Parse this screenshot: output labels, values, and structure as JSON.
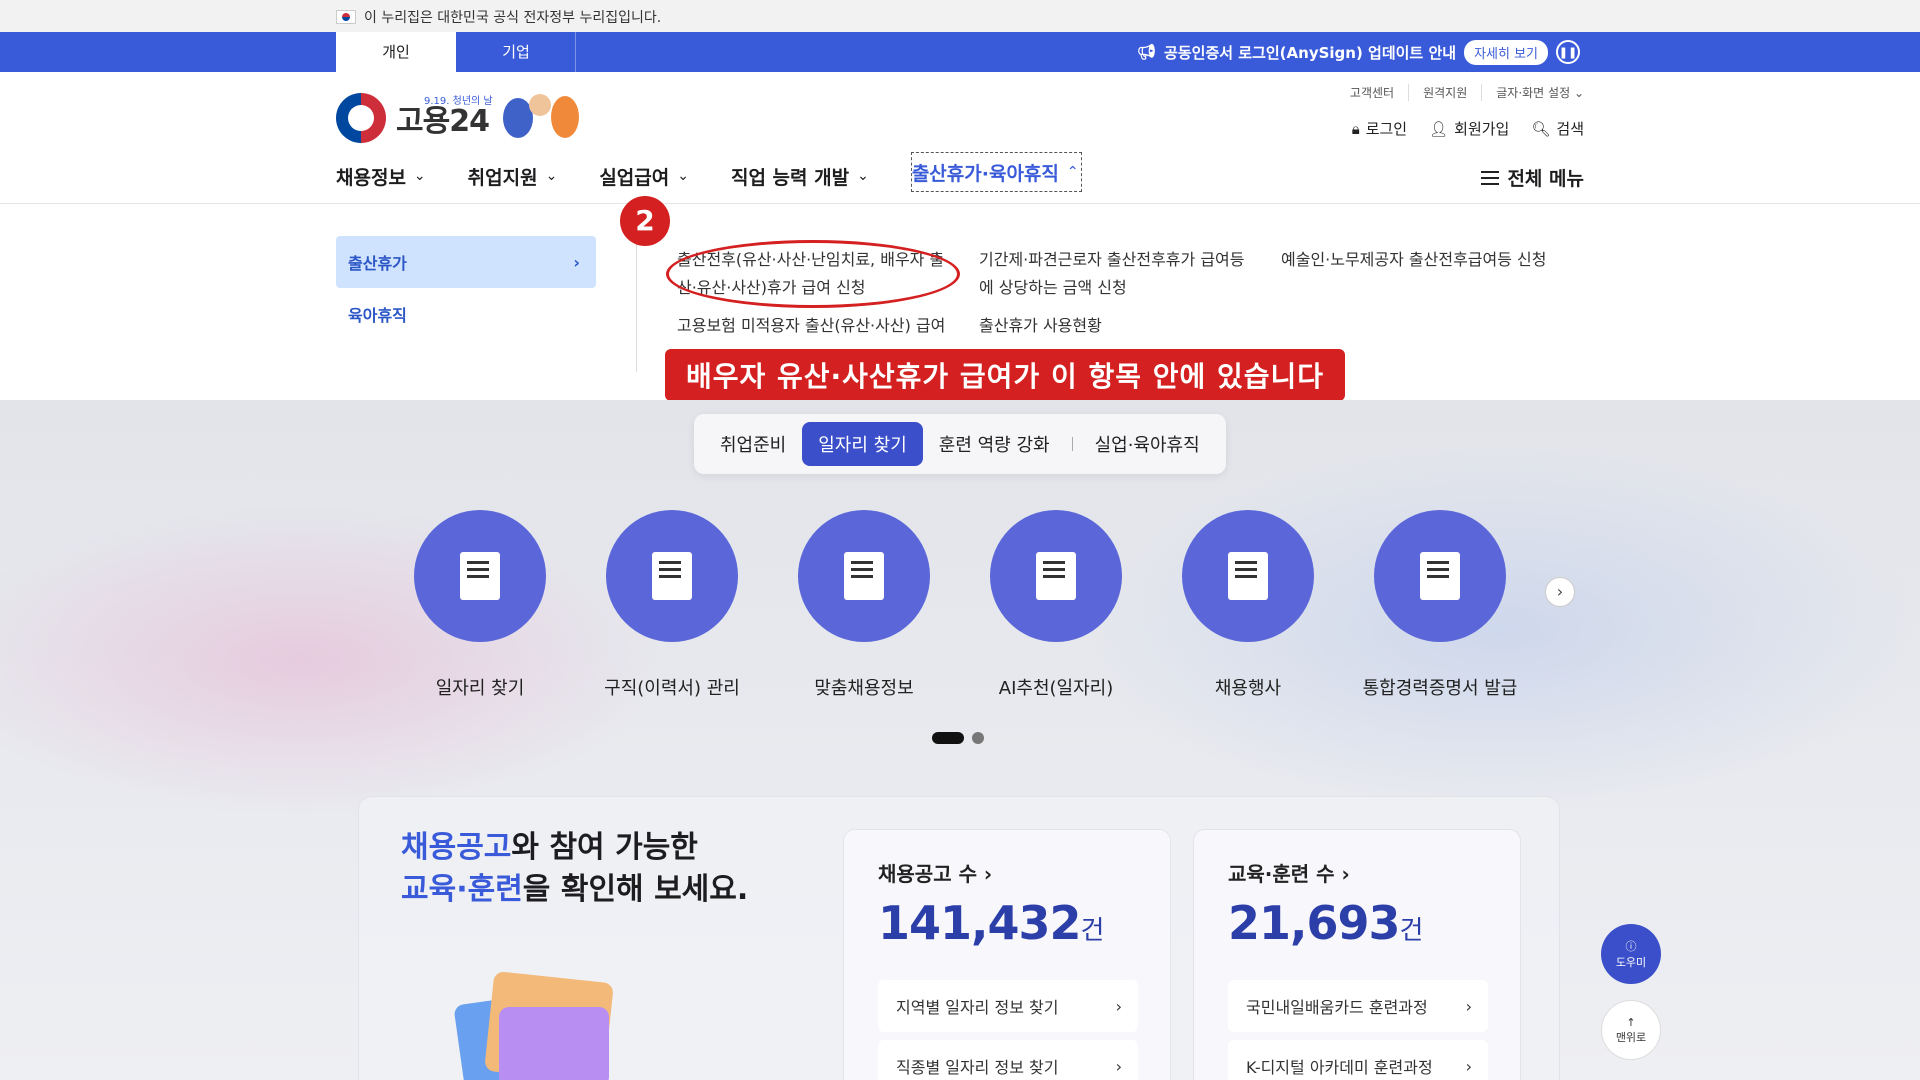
{
  "gov_banner": {
    "text": "이 누리집은 대한민국 공식 전자정부 누리집입니다."
  },
  "tabs": [
    {
      "label": "개인",
      "active": true
    },
    {
      "label": "기업",
      "active": false
    }
  ],
  "notice": {
    "text": "공동인증서 로그인(AnySign) 업데이트 안내",
    "button": "자세히 보기",
    "icon": "megaphone-icon"
  },
  "logo": {
    "sub": "9.19. 청년의 날",
    "text": "고용24"
  },
  "util_links": [
    "고객센터",
    "원격지원",
    "글자·화면 설정"
  ],
  "user_links": {
    "login": "로그인",
    "signup": "회원가입",
    "search": "검색"
  },
  "gnb": [
    {
      "label": "채용정보",
      "active": false
    },
    {
      "label": "취업지원",
      "active": false
    },
    {
      "label": "실업급여",
      "active": false
    },
    {
      "label": "직업 능력 개발",
      "active": false
    },
    {
      "label": "출산휴가·육아휴직",
      "active": true
    }
  ],
  "all_menu": "전체 메뉴",
  "mega_menu": {
    "side_items": [
      {
        "label": "출산휴가",
        "active": true
      },
      {
        "label": "육아휴직",
        "active": false
      }
    ],
    "links": [
      "출산전후(유산·사산·난임치료, 배우자 출산·유산·사산)휴가 급여 신청",
      "기간제·파견근로자 출산전후휴가 급여등에 상당하는 금액 신청",
      "예술인·노무제공자 출산전후급여등 신청",
      "고용보험 미적용자 출산(유산·사산) 급여 신청",
      "출산휴가 사용현황"
    ],
    "links_display": {
      "l1_line1": "출산전후(유산·사산·난임치료, 배우자 출",
      "l1_line2": "산·유산·사산)휴가 급여 신청",
      "l2_line1": "기간제·파견근로자 출산전후휴가 급여등",
      "l2_line2": "에 상당하는 금액 신청",
      "l4_line1": "고용보험 미적용자 출산(유산·사산) 급여"
    }
  },
  "annotation": {
    "number": "2",
    "label": "배우자 유산·사산휴가 급여가 이 항목 안에 있습니다",
    "color": "#d42020"
  },
  "chips": [
    {
      "label": "취업준비",
      "active": false
    },
    {
      "label": "일자리 찾기",
      "active": true
    },
    {
      "label": "훈련 역량 강화",
      "active": false
    },
    {
      "label": "실업·육아휴직",
      "active": false
    }
  ],
  "services": [
    {
      "label": "일자리 찾기",
      "icon": "doc-search-icon"
    },
    {
      "label": "구직(이력서) 관리",
      "icon": "doc-check-icon"
    },
    {
      "label": "맞춤채용정보",
      "icon": "puzzle-person-icon"
    },
    {
      "label": "AI추천(일자리)",
      "icon": "magic-wand-icon"
    },
    {
      "label": "채용행사",
      "icon": "calendar-star-icon"
    },
    {
      "label": "통합경력증명서 발급",
      "icon": "doc-gear-icon"
    }
  ],
  "panel": {
    "title_hl1": "채용공고",
    "title_rest1": "와 참여 가능한",
    "title_hl2": "교육·훈련",
    "title_rest2": "을 확인해 보세요.",
    "cards": [
      {
        "title": "채용공고 수",
        "value": "141,432",
        "unit": "건",
        "rows": [
          "지역별 일자리 정보 찾기",
          "직종별 일자리 정보 찾기"
        ]
      },
      {
        "title": "교육·훈련 수",
        "value": "21,693",
        "unit": "건",
        "rows": [
          "국민내일배움카드 훈련과정",
          "K-디지털 아카데미 훈련과정"
        ]
      }
    ]
  },
  "floating": {
    "help": "도우미",
    "top": "맨위로"
  },
  "colors": {
    "primary": "#3a5bd9",
    "service_circle": "#5b67d8",
    "annotation": "#d42020"
  }
}
